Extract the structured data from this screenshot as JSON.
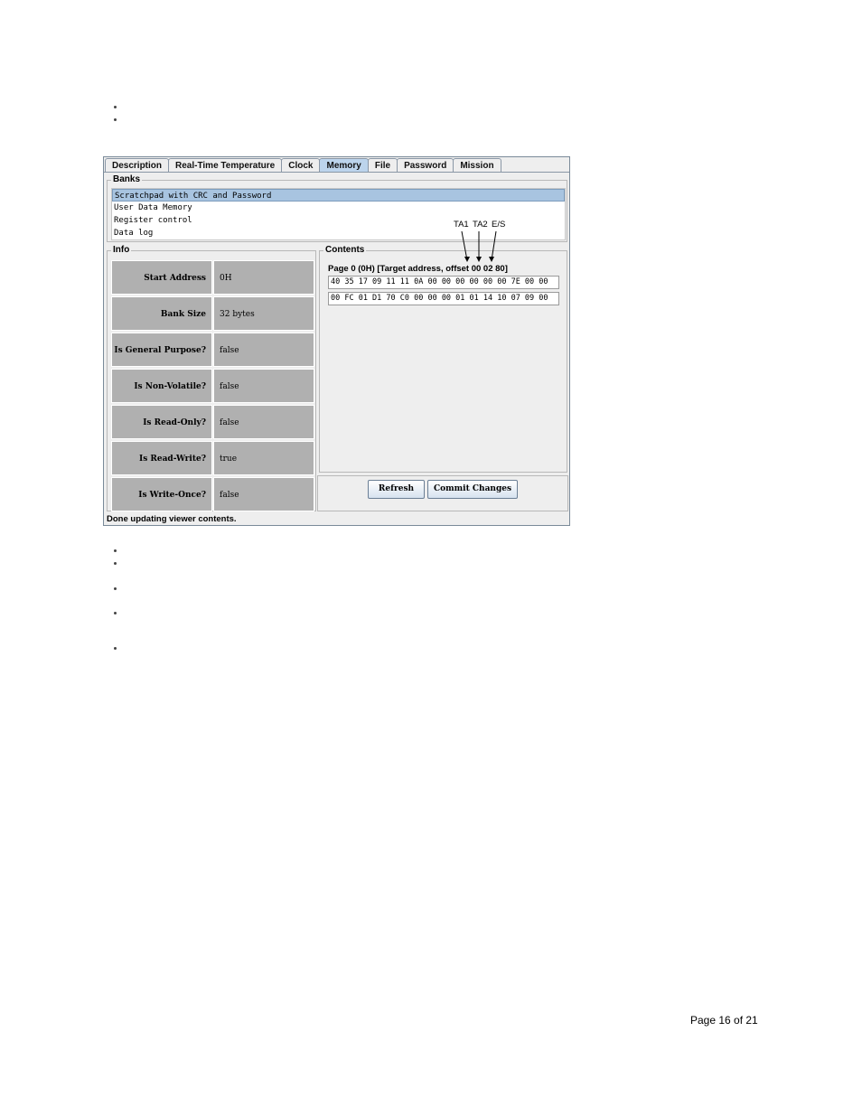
{
  "tabs": [
    "Description",
    "Real-Time Temperature",
    "Clock",
    "Memory",
    "File",
    "Password",
    "Mission"
  ],
  "active_tab": "Memory",
  "banks": {
    "label": "Banks",
    "items": [
      "Scratchpad with CRC and Password",
      "User Data Memory",
      "Register control",
      "Data log"
    ],
    "selected": "Scratchpad with CRC and Password"
  },
  "info": {
    "label": "Info",
    "rows": [
      {
        "label": "Start Address",
        "value": "0H"
      },
      {
        "label": "Bank Size",
        "value": "32 bytes"
      },
      {
        "label": "Is General Purpose?",
        "value": "false"
      },
      {
        "label": "Is Non-Volatile?",
        "value": "false"
      },
      {
        "label": "Is Read-Only?",
        "value": "false"
      },
      {
        "label": "Is Read-Write?",
        "value": "true"
      },
      {
        "label": "Is Write-Once?",
        "value": "false"
      }
    ]
  },
  "contents": {
    "label": "Contents",
    "page_caption": "Page 0 (0H) [Target address, offset 00 02 80]",
    "hex_rows": [
      "40 35 17 09 11 11 0A 00 00 00 00 00 00 7E 00 00",
      "00 FC 01 D1 70 C0 00 00 00 01 01 14 10 07 09 00"
    ]
  },
  "buttons": {
    "refresh": "Refresh",
    "commit": "Commit Changes"
  },
  "status": "Done updating viewer contents.",
  "annotations": {
    "ta1": "TA1",
    "ta2": "TA2",
    "es": "E/S"
  },
  "footer": {
    "page": "Page 16 of 21"
  }
}
